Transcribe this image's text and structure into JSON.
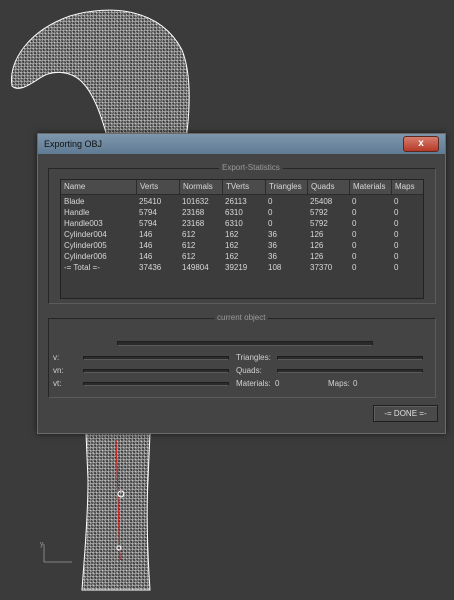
{
  "dialog": {
    "title": "Exporting OBJ",
    "close": "x"
  },
  "stats": {
    "group_label": "Export-Statistics",
    "columns": [
      "Name",
      "Verts",
      "Normals",
      "TVerts",
      "Triangles",
      "Quads",
      "Materials",
      "Maps"
    ],
    "rows": [
      [
        "Blade",
        "25410",
        "101632",
        "26113",
        "0",
        "25408",
        "0",
        "0"
      ],
      [
        "Handle",
        "5794",
        "23168",
        "6310",
        "0",
        "5792",
        "0",
        "0"
      ],
      [
        "Handle003",
        "5794",
        "23168",
        "6310",
        "0",
        "5792",
        "0",
        "0"
      ],
      [
        "Cylinder004",
        "146",
        "612",
        "162",
        "36",
        "126",
        "0",
        "0"
      ],
      [
        "Cylinder005",
        "146",
        "612",
        "162",
        "36",
        "126",
        "0",
        "0"
      ],
      [
        "Cylinder006",
        "146",
        "612",
        "162",
        "36",
        "126",
        "0",
        "0"
      ],
      [
        "-= Total =-",
        "37436",
        "149804",
        "39219",
        "108",
        "37370",
        "0",
        "0"
      ]
    ]
  },
  "current": {
    "group_label": "current object",
    "v_label": "v:",
    "vn_label": "vn:",
    "vt_label": "vt:",
    "triangles_label": "Triangles:",
    "quads_label": "Quads:",
    "materials_label": "Materials:",
    "materials_value": "0",
    "maps_label": "Maps:",
    "maps_value": "0"
  },
  "done_button": "-= DONE =-",
  "viewport": {
    "axis_label": "y"
  }
}
